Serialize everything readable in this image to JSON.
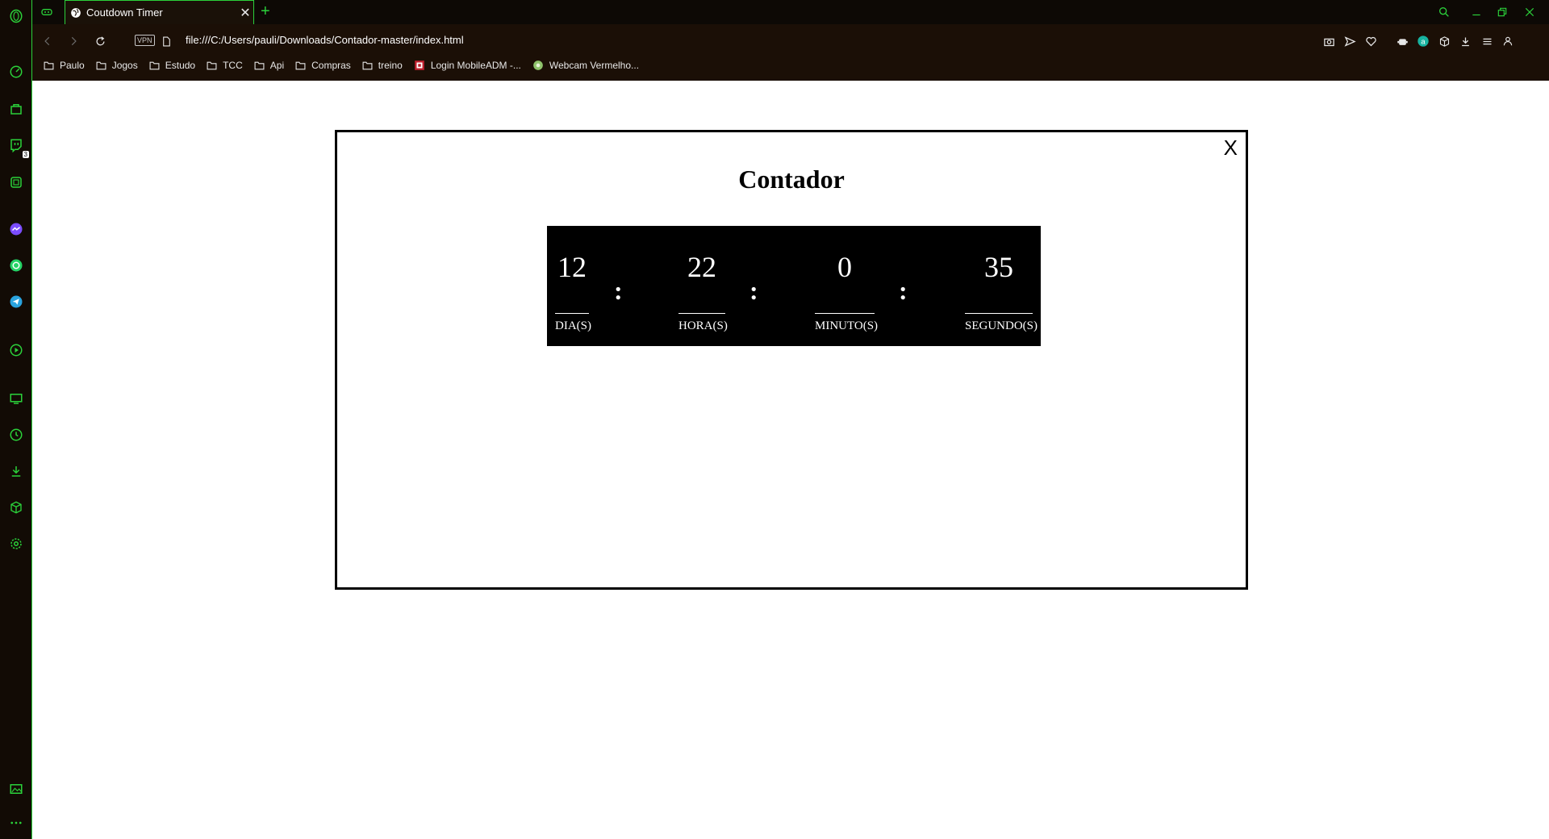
{
  "browser": {
    "tab_title": "Coutdown Timer",
    "tab_close": "✕",
    "new_tab": "+",
    "vpn_label": "VPN",
    "url": "file:///C:/Users/pauli/Downloads/Contador-master/index.html",
    "accent_color": "#2bd13a"
  },
  "bookmarks": [
    {
      "label": "Paulo",
      "icon": "folder-icon"
    },
    {
      "label": "Jogos",
      "icon": "folder-icon"
    },
    {
      "label": "Estudo",
      "icon": "folder-icon"
    },
    {
      "label": "TCC",
      "icon": "folder-icon"
    },
    {
      "label": "Api",
      "icon": "folder-icon"
    },
    {
      "label": "Compras",
      "icon": "folder-icon"
    },
    {
      "label": "treino",
      "icon": "folder-icon"
    },
    {
      "label": "Login MobileADM -...",
      "icon": "site-favicon"
    },
    {
      "label": "Webcam Vermelho...",
      "icon": "site-favicon"
    }
  ],
  "sidebar": {
    "badge_count": "3"
  },
  "page": {
    "close_label": "X",
    "title": "Contador",
    "timer": {
      "days": {
        "value": "12",
        "label": "DIA(S)"
      },
      "hours": {
        "value": "22",
        "label": "HORA(S)"
      },
      "minutes": {
        "value": "0",
        "label": "MINUTO(S)"
      },
      "seconds": {
        "value": "35",
        "label": "SEGUNDO(S)"
      },
      "separator": ":"
    }
  }
}
